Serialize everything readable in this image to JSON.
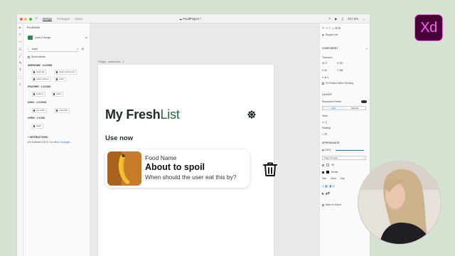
{
  "titlebar": {
    "modes": [
      "Design",
      "Prototype",
      "Share"
    ],
    "active_mode": "Design",
    "file_name": "FoodProject *",
    "zoom": "217.5%"
  },
  "left_panel": {
    "header": "PLUGINS",
    "plugin_name": "Icons 4 Design",
    "search_value": "trash",
    "show_names": "Show names",
    "groups": [
      {
        "label": "AWESOME",
        "count": "4 ICONS",
        "items": [
          "trash alt",
          "trash-restore-alt",
          "trash-restore",
          "trash"
        ]
      },
      {
        "label": "FEATHER",
        "count": "2 ICONS",
        "items": [
          "trash-2",
          "trash"
        ]
      },
      {
        "label": "IONIC",
        "count": "2 ICONS",
        "items": [
          "ios-trash",
          "md-trash"
        ]
      },
      {
        "label": "OPEN",
        "count": "1 ICON",
        "items": [
          "trash"
        ]
      }
    ],
    "instructions_header": "INSTRUCTIONS",
    "instructions_text": "Dirt Software ©2019. Our other",
    "instructions_link": "Xd plugins"
  },
  "artboard": {
    "label": "Fridge - saved tips - 1",
    "title_main": "My Fresh",
    "title_accent": "List",
    "section": "Use now",
    "card": {
      "label": "Food Name",
      "title": "About to spoil",
      "subtitle": "When should the user eat this by?"
    }
  },
  "right_panel": {
    "repeat_grid": "Repeat Grid",
    "component": "COMPONENT",
    "transform": "Transform",
    "w_label": "W",
    "w_value": "27",
    "x_label": "X",
    "x_value": "332",
    "h_label": "H",
    "h_value": "36",
    "y_label": "Y",
    "y_value": "308",
    "fix_position": "Fix Position When Scrolling",
    "layout": "LAYOUT",
    "responsive_resize": "Responsive Resize",
    "resize_auto": "Auto",
    "resize_manual": "Manual",
    "stack": "Stack",
    "padding": "Padding",
    "appearance": "APPEARANCE",
    "opacity": "100%",
    "blend": "Pass Through",
    "fill": "Fill",
    "border": "Border",
    "size_label": "Size",
    "dash_label": "Dash",
    "gap_label": "Gap",
    "mark_export": "Mark for Export"
  },
  "colors": {
    "accent_green": "#1f6b3d",
    "xd_bg": "#470137",
    "xd_pink": "#ff61f6",
    "banana": "#f2c230"
  },
  "app_badge": "Xd"
}
